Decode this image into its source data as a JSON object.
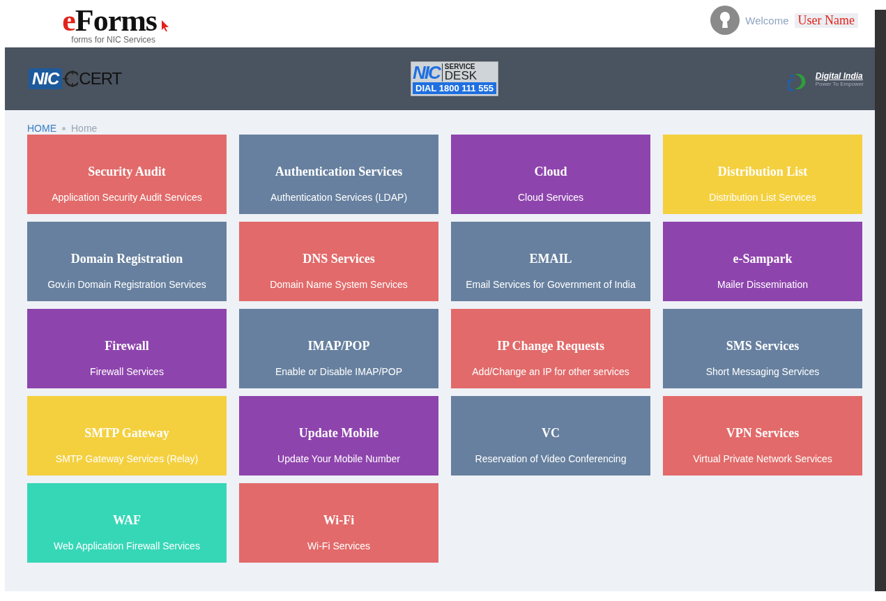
{
  "header": {
    "logo": {
      "accent": "e",
      "rest": "Forms",
      "tagline": "forms for NIC Services"
    },
    "welcome": {
      "label": "Welcome",
      "user": "User Name"
    }
  },
  "banner": {
    "cert": {
      "nic": "NIC",
      "cert": "CERT"
    },
    "service_desk": {
      "nic": "NIC",
      "top": "SERVICE",
      "bottom": "DESK",
      "dial": "DIAL 1800 111 555"
    },
    "digital_india": {
      "name": "Digital India",
      "tagline": "Power To Empower"
    }
  },
  "breadcrumb": [
    {
      "label": "HOME"
    },
    {
      "label": "Home"
    }
  ],
  "tiles": [
    {
      "title": "Security Audit",
      "subtitle": "Application Security Audit Services",
      "color": "#e26a6a"
    },
    {
      "title": "Authentication Services",
      "subtitle": "Authentication Services (LDAP)",
      "color": "#67809f"
    },
    {
      "title": "Cloud",
      "subtitle": "Cloud Services",
      "color": "#8e44ad"
    },
    {
      "title": "Distribution List",
      "subtitle": "Distribution List Services",
      "color": "#f4d03f"
    },
    {
      "title": "Domain Registration",
      "subtitle": "Gov.in Domain Registration Services",
      "color": "#67809f"
    },
    {
      "title": "DNS Services",
      "subtitle": "Domain Name System Services",
      "color": "#e26a6a"
    },
    {
      "title": "EMAIL",
      "subtitle": "Email Services for Government of India",
      "color": "#67809f"
    },
    {
      "title": "e-Sampark",
      "subtitle": "Mailer Dissemination",
      "color": "#8e44ad"
    },
    {
      "title": "Firewall",
      "subtitle": "Firewall Services",
      "color": "#8e44ad"
    },
    {
      "title": "IMAP/POP",
      "subtitle": "Enable or Disable IMAP/POP",
      "color": "#67809f"
    },
    {
      "title": "IP Change Requests",
      "subtitle": "Add/Change an IP for other services",
      "color": "#e26a6a"
    },
    {
      "title": "SMS Services",
      "subtitle": "Short Messaging Services",
      "color": "#67809f"
    },
    {
      "title": "SMTP Gateway",
      "subtitle": "SMTP Gateway Services (Relay)",
      "color": "#f4d03f"
    },
    {
      "title": "Update Mobile",
      "subtitle": "Update Your Mobile Number",
      "color": "#8e44ad"
    },
    {
      "title": "VC",
      "subtitle": "Reservation of Video Conferencing",
      "color": "#67809f"
    },
    {
      "title": "VPN Services",
      "subtitle": "Virtual Private Network Services",
      "color": "#e26a6a"
    },
    {
      "title": "WAF",
      "subtitle": "Web Application Firewall Services",
      "color": "#36d7b7"
    },
    {
      "title": "Wi-Fi",
      "subtitle": "Wi-Fi Services",
      "color": "#e26a6a"
    }
  ]
}
